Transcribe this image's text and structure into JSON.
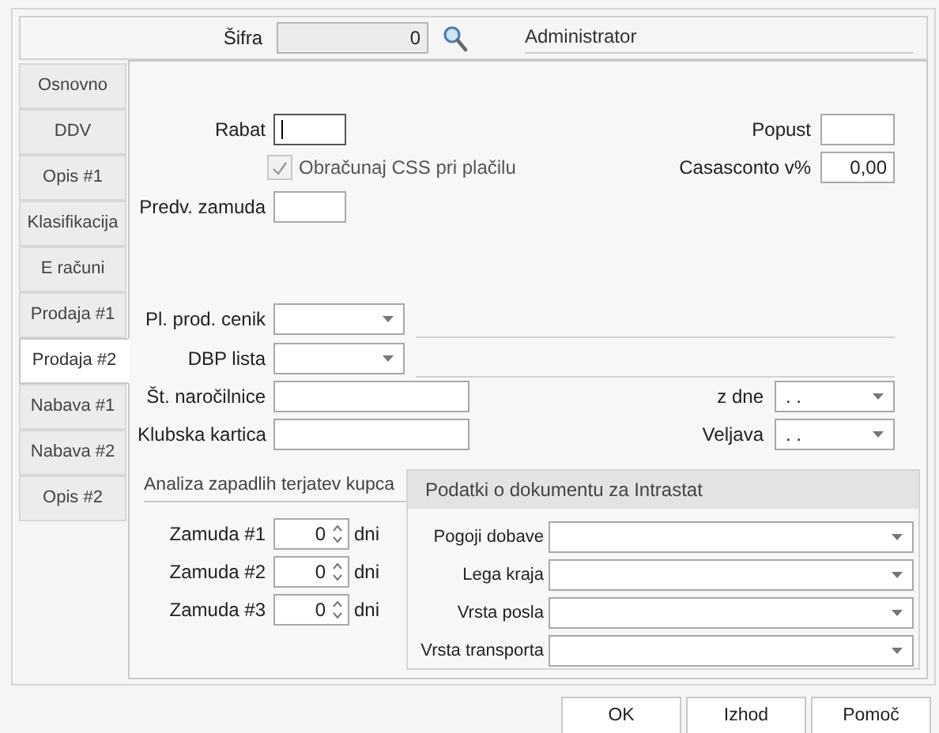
{
  "header": {
    "code_label": "Šifra",
    "code_value": "0",
    "user": "Administrator"
  },
  "tabs": [
    {
      "label": "Osnovno",
      "selected": false
    },
    {
      "label": "DDV",
      "selected": false
    },
    {
      "label": "Opis #1",
      "selected": false
    },
    {
      "label": "Klasifikacija",
      "selected": false
    },
    {
      "label": "E računi",
      "selected": false
    },
    {
      "label": "Prodaja #1",
      "selected": false
    },
    {
      "label": "Prodaja #2",
      "selected": true
    },
    {
      "label": "Nabava #1",
      "selected": false
    },
    {
      "label": "Nabava #2",
      "selected": false
    },
    {
      "label": "Opis #2",
      "selected": false
    }
  ],
  "rabat": {
    "label": "Rabat",
    "focused": true
  },
  "popust": {
    "label": "Popust"
  },
  "css_checkbox": {
    "label": "Obračunaj CSS pri plačilu",
    "checked": true,
    "disabled": true
  },
  "casasconto": {
    "label": "Casasconto v%",
    "value": "0,00"
  },
  "predv_zamuda": {
    "label": "Predv. zamuda"
  },
  "price_list": {
    "label": "Pl. prod. cenik"
  },
  "dbp_list": {
    "label": "DBP lista"
  },
  "order_no": {
    "label": "Št. naročilnice"
  },
  "order_date": {
    "label": "z dne",
    "value": ". ."
  },
  "club_card": {
    "label": "Klubska kartica"
  },
  "validity": {
    "label": "Veljava",
    "value": ". ."
  },
  "overdue": {
    "title": "Analiza zapadlih terjatev kupca",
    "rows": [
      {
        "label": "Zamuda #1",
        "value": "0",
        "unit": "dni"
      },
      {
        "label": "Zamuda #2",
        "value": "0",
        "unit": "dni"
      },
      {
        "label": "Zamuda #3",
        "value": "0",
        "unit": "dni"
      }
    ]
  },
  "intrastat": {
    "title": "Podatki o dokumentu za Intrastat",
    "rows": [
      {
        "label": "Pogoji dobave"
      },
      {
        "label": "Lega kraja"
      },
      {
        "label": "Vrsta posla"
      },
      {
        "label": "Vrsta transporta"
      }
    ]
  },
  "buttons": [
    "OK",
    "Izhod",
    "Pomoč"
  ]
}
